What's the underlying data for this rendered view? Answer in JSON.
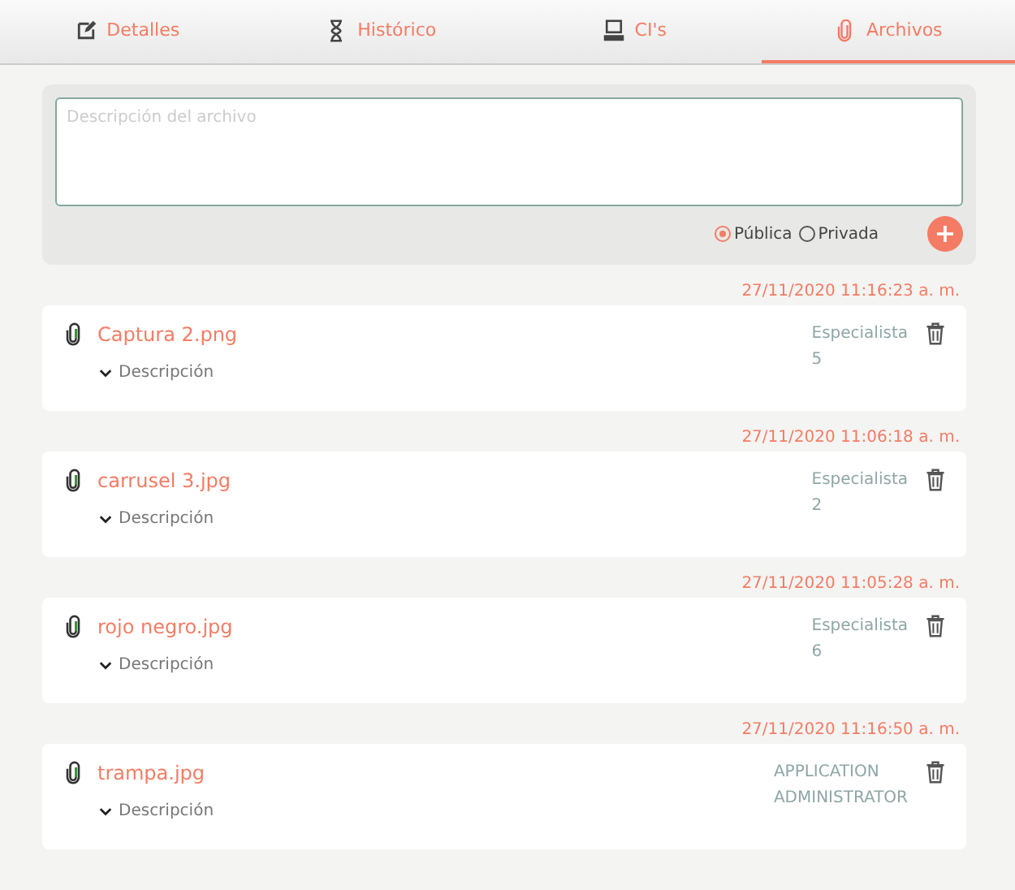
{
  "tabs": [
    {
      "label": "Detalles",
      "selected": false
    },
    {
      "label": "Histórico",
      "selected": false
    },
    {
      "label": "CI's",
      "selected": false
    },
    {
      "label": "Archivos",
      "selected": true
    }
  ],
  "upload": {
    "placeholder": "Descripción del archivo",
    "visibility": [
      {
        "label": "Pública",
        "selected": true
      },
      {
        "label": "Privada",
        "selected": false
      }
    ],
    "add_button": "+"
  },
  "files": [
    {
      "timestamp": "27/11/2020 11:16:23 a. m.",
      "name": "Captura 2.png",
      "author": "Especialista 5",
      "description": "Descripción"
    },
    {
      "timestamp": "27/11/2020 11:06:18 a. m.",
      "name": "carrusel 3.jpg",
      "author": "Especialista 2",
      "description": "Descripción"
    },
    {
      "timestamp": "27/11/2020 11:05:28 a. m.",
      "name": "rojo negro.jpg",
      "author": "Especialista 6",
      "description": "Descripción"
    },
    {
      "timestamp": "27/11/2020 11:16:50 a. m.",
      "name": "trampa.jpg",
      "author": "APPLICATION ADMINISTRATOR",
      "description": "Descripción"
    }
  ]
}
